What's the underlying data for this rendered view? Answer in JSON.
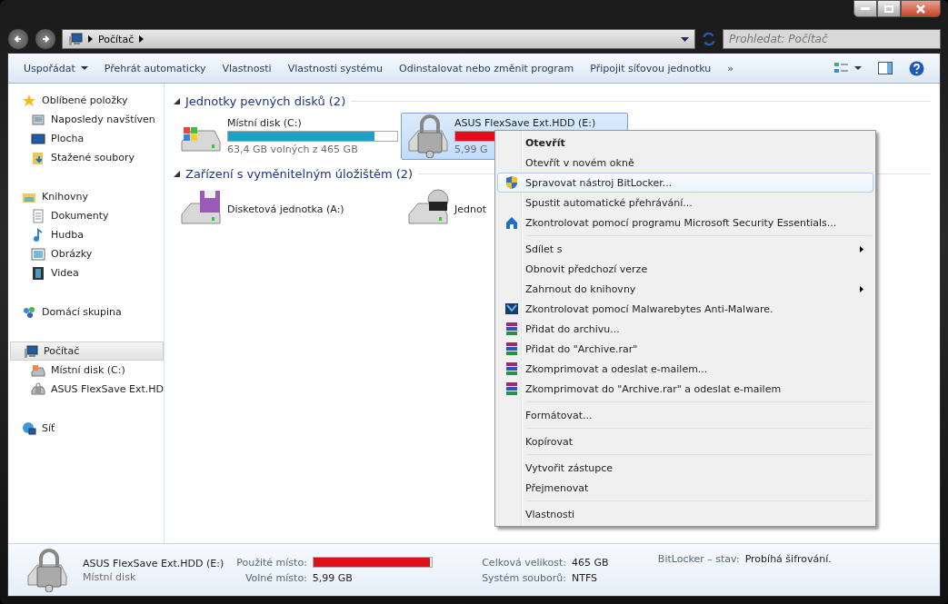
{
  "window": {
    "title_path": [
      "Počítač"
    ],
    "search": {
      "placeholder": "Prohledat: Počítač"
    }
  },
  "toolbar": {
    "items": [
      {
        "label": "Uspořádat",
        "dropdown": true
      },
      {
        "label": "Přehrát automaticky",
        "dropdown": false
      },
      {
        "label": "Vlastnosti",
        "dropdown": false
      },
      {
        "label": "Vlastnosti systému",
        "dropdown": false
      },
      {
        "label": "Odinstalovat nebo změnit program",
        "dropdown": false
      },
      {
        "label": "Připojit síťovou jednotku",
        "dropdown": false
      }
    ],
    "more": "»"
  },
  "sidebar": {
    "groups": [
      {
        "label": "Oblíbené položky",
        "kind": "star",
        "selected": false,
        "children": [
          {
            "label": "Naposledy navštíven",
            "kind": "recent",
            "selected": false
          },
          {
            "label": "Plocha",
            "kind": "desktop",
            "selected": false
          },
          {
            "label": "Stažené soubory",
            "kind": "downloads",
            "selected": false
          }
        ]
      },
      {
        "label": "Knihovny",
        "kind": "library",
        "selected": false,
        "children": [
          {
            "label": "Dokumenty",
            "kind": "document",
            "selected": false
          },
          {
            "label": "Hudba",
            "kind": "music",
            "selected": false
          },
          {
            "label": "Obrázky",
            "kind": "picture",
            "selected": false
          },
          {
            "label": "Videa",
            "kind": "video",
            "selected": false
          }
        ]
      },
      {
        "label": "Domácí skupina",
        "kind": "homegroup",
        "selected": false
      },
      {
        "label": "Počítač",
        "kind": "computer",
        "selected": true,
        "children": [
          {
            "label": "Místní disk (C:)",
            "kind": "windrive",
            "selected": false
          },
          {
            "label": "ASUS FlexSave Ext.HD",
            "kind": "lockdrive",
            "selected": false
          }
        ]
      },
      {
        "label": "Síť",
        "kind": "network",
        "selected": false
      }
    ]
  },
  "sections": [
    {
      "title": "Jednotky pevných disků (2)",
      "drives": [
        {
          "name": "Místní disk (C:)",
          "kind": "windrive",
          "level": 0.864,
          "free": "63,4 GB volných z 465 GB",
          "selected": false,
          "color": "#1ea0c8"
        },
        {
          "name": "ASUS FlexSave Ext.HDD (E:)",
          "kind": "lockdrive",
          "level": 0.987,
          "free": "5,99 G",
          "selected": true,
          "color": "#e0101a"
        }
      ]
    },
    {
      "title": "Zařízení s vyměnitelným úložištěm (2)",
      "drives": [
        {
          "name": "Disketová jednotka (A:)",
          "kind": "floppy",
          "selected": false
        },
        {
          "name": "Jednot",
          "kind": "bluray",
          "selected": false
        }
      ]
    }
  ],
  "context_menu": {
    "groups": [
      [
        {
          "label": "Otevřít",
          "bold": true,
          "kind": "plain",
          "submenu": false,
          "selected": false
        },
        {
          "label": "Otevřít v novém okně",
          "bold": false,
          "kind": "plain",
          "submenu": false,
          "selected": false
        },
        {
          "label": "Spravovat nástroj BitLocker...",
          "bold": false,
          "kind": "shield",
          "submenu": false,
          "selected": true
        },
        {
          "label": "Spustit automatické přehrávání...",
          "bold": false,
          "kind": "plain",
          "submenu": false,
          "selected": false
        },
        {
          "label": "Zkontrolovat pomocí programu Microsoft Security Essentials...",
          "bold": false,
          "kind": "house",
          "submenu": false,
          "selected": false
        }
      ],
      [
        {
          "label": "Sdílet s",
          "bold": false,
          "kind": "plain",
          "submenu": true,
          "selected": false
        },
        {
          "label": "Obnovit předchozí verze",
          "bold": false,
          "kind": "plain",
          "submenu": false,
          "selected": false
        },
        {
          "label": "Zahrnout do knihovny",
          "bold": false,
          "kind": "plain",
          "submenu": true,
          "selected": false
        },
        {
          "label": "Zkontrolovat pomocí Malwarebytes Anti-Malware.",
          "bold": false,
          "kind": "mbam",
          "submenu": false,
          "selected": false
        },
        {
          "label": "Přidat do archivu...",
          "bold": false,
          "kind": "books",
          "submenu": false,
          "selected": false
        },
        {
          "label": "Přidat do \"Archive.rar\"",
          "bold": false,
          "kind": "books",
          "submenu": false,
          "selected": false
        },
        {
          "label": "Zkomprimovat a odeslat e-mailem...",
          "bold": false,
          "kind": "books",
          "submenu": false,
          "selected": false
        },
        {
          "label": "Zkomprimovat do \"Archive.rar\" a odeslat e-mailem",
          "bold": false,
          "kind": "books",
          "submenu": false,
          "selected": false
        }
      ],
      [
        {
          "label": "Formátovat...",
          "bold": false,
          "kind": "plain",
          "submenu": false,
          "selected": false
        }
      ],
      [
        {
          "label": "Kopírovat",
          "bold": false,
          "kind": "plain",
          "submenu": false,
          "selected": false
        }
      ],
      [
        {
          "label": "Vytvořit zástupce",
          "bold": false,
          "kind": "plain",
          "submenu": false,
          "selected": false
        },
        {
          "label": "Přejmenovat",
          "bold": false,
          "kind": "plain",
          "submenu": false,
          "selected": false
        }
      ],
      [
        {
          "label": "Vlastnosti",
          "bold": false,
          "kind": "plain",
          "submenu": false,
          "selected": false
        }
      ]
    ]
  },
  "status_bar": {
    "name": "ASUS FlexSave Ext.HDD (E:)",
    "type": "Místní disk",
    "used": {
      "label": "Použité místo:",
      "level": 0.987
    },
    "free_label": "Volné místo:",
    "free_value": "5,99 GB",
    "total_label": "Celková velikost:",
    "total_value": "465 GB",
    "fs_label": "Systém souborů:",
    "fs_value": "NTFS",
    "bitlocker_label": "BitLocker – stav:",
    "bitlocker_value": "Probíhá šifrování."
  }
}
